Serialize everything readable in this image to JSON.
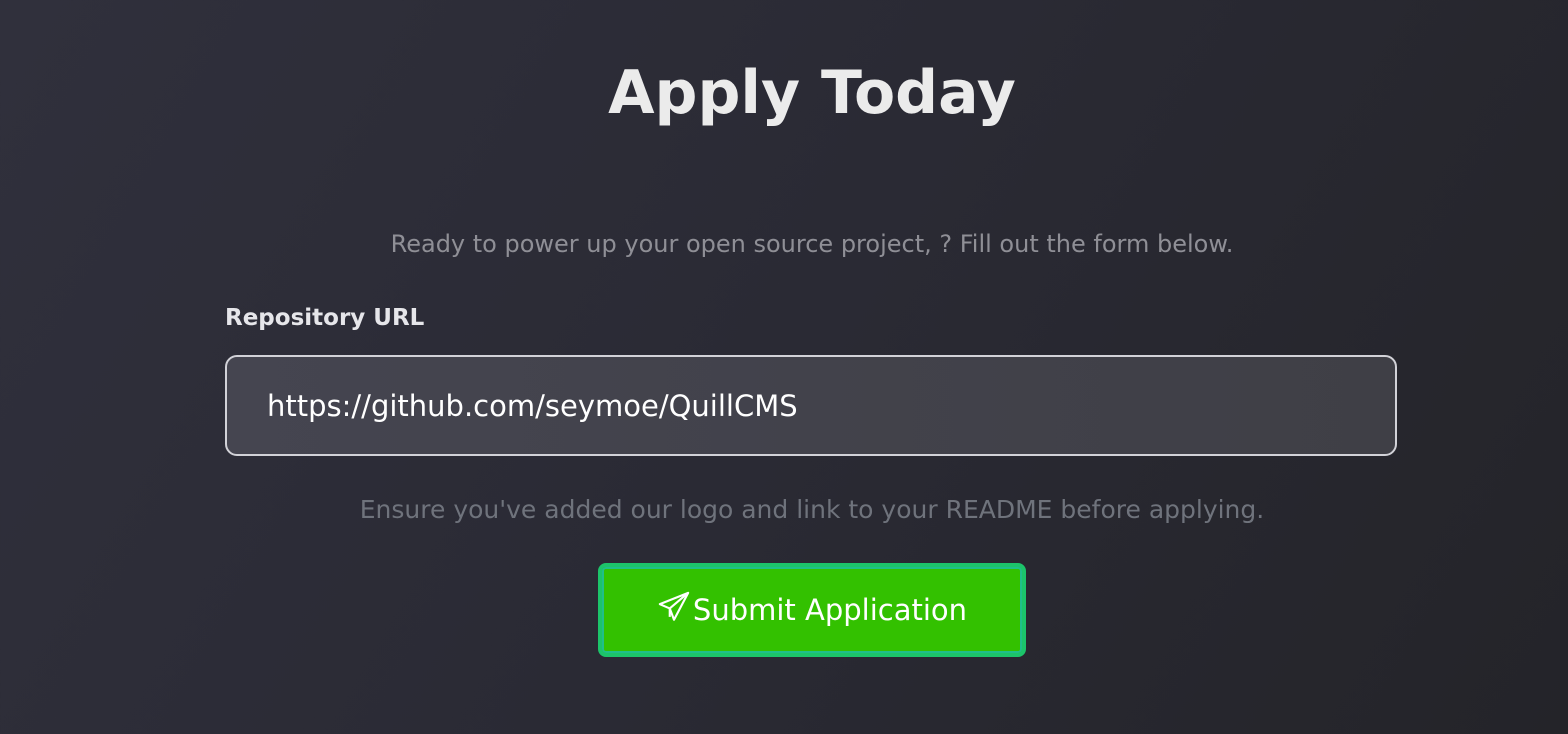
{
  "header": {
    "title": "Apply Today",
    "subtitle": "Ready to power up your open source project, ? Fill out the form below."
  },
  "form": {
    "repo_label": "Repository URL",
    "repo_value": "https://github.com/seymoe/QuillCMS",
    "note": "Ensure you've added our logo and link to your README before applying.",
    "submit_label": "Submit Application",
    "submit_icon": "paper-plane-icon",
    "submit_color": "#33c100"
  }
}
